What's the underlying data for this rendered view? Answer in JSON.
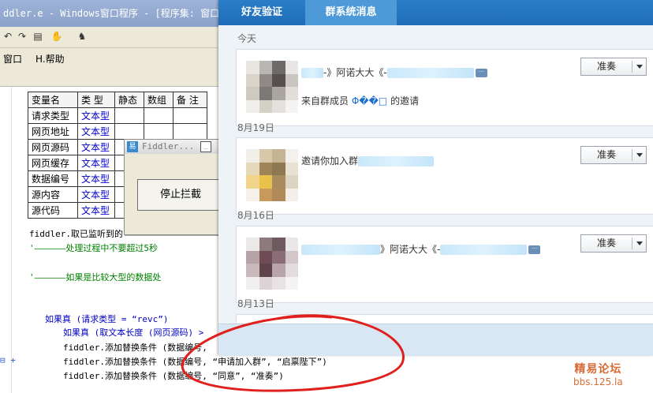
{
  "ide": {
    "title": "ddler.e - Windows窗口程序 - [程序集: 窗口",
    "menu": {
      "window": "窗口",
      "help": "H.帮助"
    },
    "table": {
      "headers": [
        "变量名",
        "类 型",
        "静态",
        "数组",
        "备 注"
      ],
      "rows": [
        [
          "请求类型",
          "文本型"
        ],
        [
          "网页地址",
          "文本型"
        ],
        [
          "网页源码",
          "文本型"
        ],
        [
          "网页缓存",
          "文本型"
        ],
        [
          "数据编号",
          "文本型"
        ],
        [
          "源内容",
          "文本型"
        ],
        [
          "源代码",
          "文本型"
        ]
      ]
    },
    "code": {
      "line_fiddler_call": "fiddler.取已监听到的",
      "comment1": "'——————处理过程中不要超过5秒",
      "comment2": "'——————如果是比较大型的数据处",
      "if_line": "如果真 (请求类型 = “revc”)",
      "if_inner": "如果真 (取文本长度 (网页源码) >",
      "add1": "fiddler.添加替换条件 (数据编号,",
      "add2": "fiddler.添加替换条件 (数据编号, “申请加入群”, “启禀陛下”)",
      "add3": "fiddler.添加替换条件 (数据编号, “同意”, “准奏”)"
    }
  },
  "fiddler_dialog": {
    "title": "Fiddler...",
    "stop_button": "停止拦截"
  },
  "message_window": {
    "tabs": {
      "friend": "好友验证",
      "group": "群系统消息"
    },
    "sections": [
      {
        "date": "今天",
        "text_a": "-》阿诺大大《-",
        "text_b": "来自群成员",
        "member": "Φ��□",
        "text_c": "的邀请",
        "button": "准奏"
      },
      {
        "date": "8月19日",
        "text_a": "邀请你加入群",
        "button": "准奏"
      },
      {
        "date": "8月16日",
        "text_a": "》阿诺大大《-",
        "button": "准奏"
      },
      {
        "date": "8月13日"
      }
    ]
  },
  "watermark": {
    "title": "精易论坛",
    "url": "bbs.125.la"
  }
}
